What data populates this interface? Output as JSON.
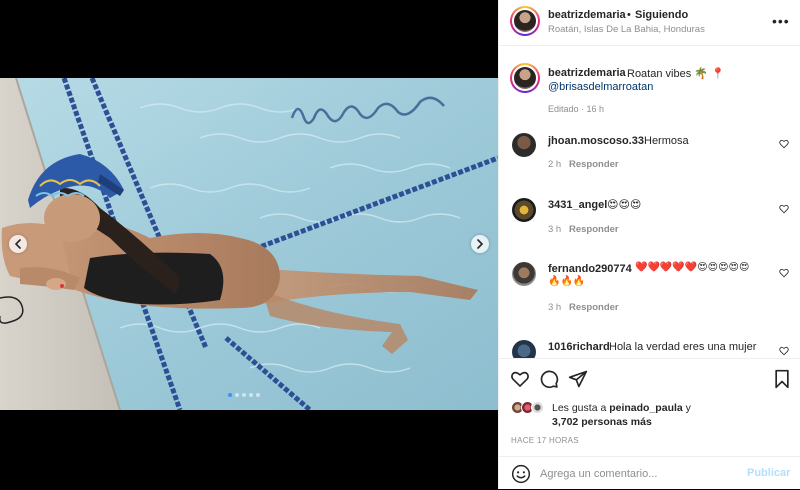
{
  "header": {
    "username": "beatrizdemaria",
    "separator": "•",
    "follow_status": "Siguiendo",
    "location": "Roatán, Islas De La Bahia, Honduras",
    "more_icon": "more-horizontal-icon"
  },
  "caption": {
    "username": "beatrizdemaria",
    "text": "Roatan vibes 🌴 📍",
    "mention": "@brisasdelmarroatan",
    "meta": "Editado · 16 h"
  },
  "comments": [
    {
      "username": "jhoan.moscoso.33",
      "text": "Hermosa",
      "time": "2 h",
      "reply": "Responder"
    },
    {
      "username": "3431_angel",
      "text": "😍😍😍",
      "time": "3 h",
      "reply": "Responder"
    },
    {
      "username": "fernando290774",
      "text": "❤️❤️❤️❤️❤️😍😍😍😍😍",
      "text2": "🔥🔥🔥",
      "time": "3 h",
      "reply": "Responder"
    },
    {
      "username": "1016richard",
      "text": "Hola la verdad eres una mujer"
    }
  ],
  "likes": {
    "prefix": "Les gusta a",
    "user": "peinado_paula",
    "suffix": "y",
    "count": "3,702 personas más"
  },
  "time_ago": "HACE 17 HORAS",
  "comment_box": {
    "placeholder": "Agrega un comentario...",
    "publish_label": "Publicar"
  },
  "carousel": {
    "total": 5,
    "active_index": 0
  },
  "colors": {
    "accent": "#3897f0",
    "publish_disabled": "#b2dffc",
    "mention": "#00376b",
    "pool": "#9ec9da"
  }
}
